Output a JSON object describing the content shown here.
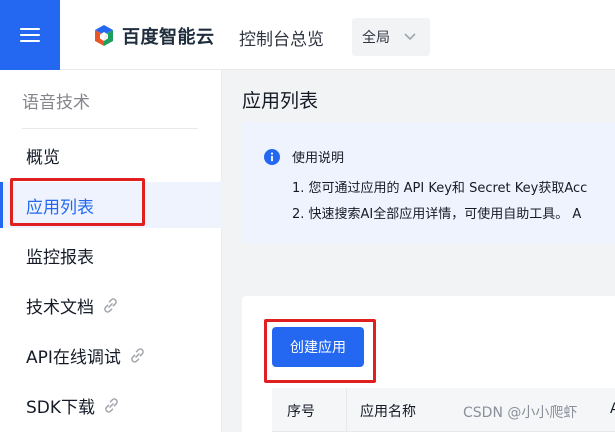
{
  "header": {
    "menu_icon": "hamburger-menu-icon",
    "logo_text": "百度智能云",
    "console_link": "控制台总览",
    "region": {
      "selected": "全局"
    }
  },
  "sidebar": {
    "title": "语音技术",
    "items": [
      {
        "label": "概览",
        "has_link_icon": false,
        "active": false
      },
      {
        "label": "应用列表",
        "has_link_icon": false,
        "active": true
      },
      {
        "label": "监控报表",
        "has_link_icon": false,
        "active": false
      },
      {
        "label": "技术文档",
        "has_link_icon": true,
        "active": false
      },
      {
        "label": "API在线调试",
        "has_link_icon": true,
        "active": false
      },
      {
        "label": "SDK下载",
        "has_link_icon": true,
        "active": false
      }
    ]
  },
  "main": {
    "title": "应用列表",
    "notice": {
      "title": "使用说明",
      "line1": "1. 您可通过应用的 API Key和 Secret Key获取Acc",
      "line2": "2. 快速搜索AI全部应用详情，可使用自助工具。 A"
    },
    "create_button": "创建应用",
    "table": {
      "columns": [
        "序号",
        "应用名称",
        "A"
      ]
    }
  },
  "watermark": "CSDN @小小爬虾",
  "colors": {
    "brand": "#2468f2",
    "highlight": "#e02020",
    "notice_bg": "#eef3fe"
  }
}
